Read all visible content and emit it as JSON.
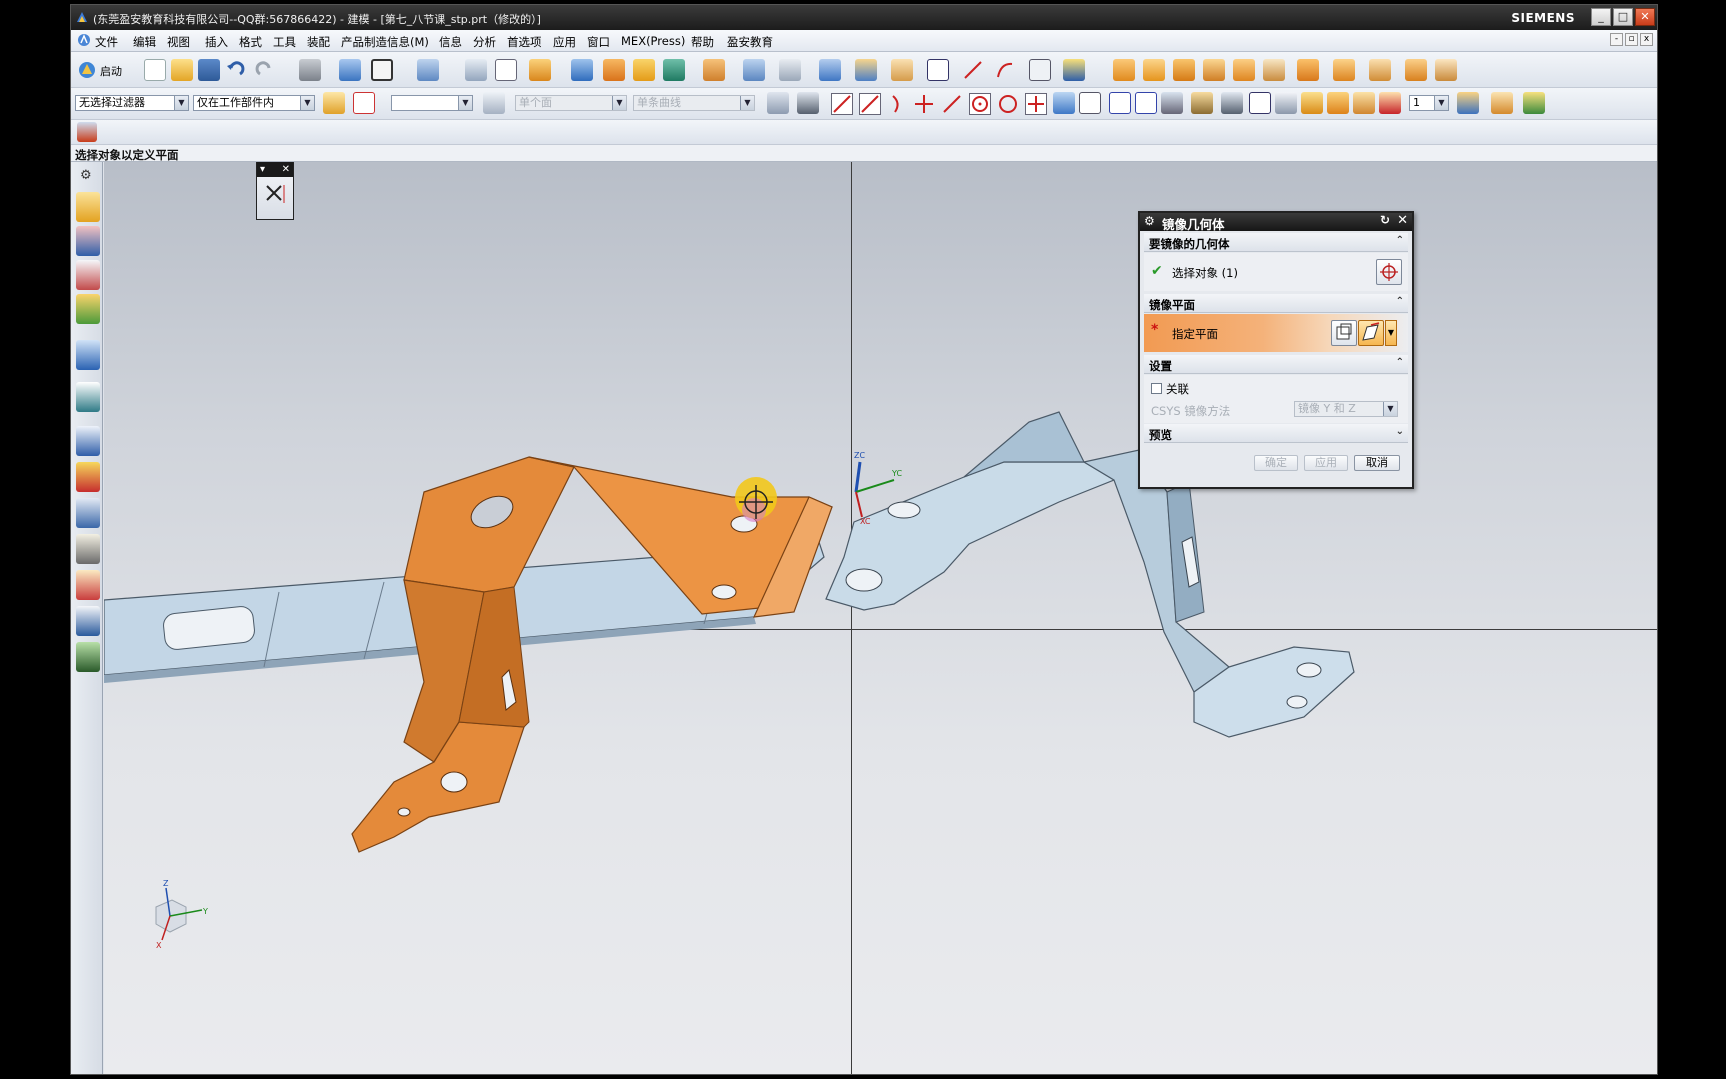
{
  "window": {
    "title": "(东莞盈安教育科技有限公司--QQ群:567866422) - 建模 - [第七_八节课_stp.prt（修改的）]",
    "brand": "SIEMENS"
  },
  "menu": [
    "文件",
    "编辑",
    "视图",
    "插入",
    "格式",
    "工具",
    "装配",
    "产品制造信息(M)",
    "信息",
    "分析",
    "首选项",
    "应用",
    "窗口",
    "MEX(Press)",
    "帮助",
    "盈安教育"
  ],
  "toolbar": {
    "start_label": "启动",
    "filter_value": "无选择过滤器",
    "scope_value": "仅在工作部件内",
    "face_rule": "单个面",
    "curve_rule": "单条曲线",
    "snap_count": "1"
  },
  "cue_line": "选择对象以定义平面",
  "dialog": {
    "title": "镜像几何体",
    "group1": "要镜像的几何体",
    "select_objects": "选择对象 (1)",
    "group2": "镜像平面",
    "specify_plane": "指定平面",
    "group3": "设置",
    "associative": "关联",
    "csys_method_label": "CSYS 镜像方法",
    "csys_method_value": "镜像 Y 和 Z",
    "group4": "预览",
    "ok": "确定",
    "apply": "应用",
    "cancel": "取消"
  },
  "axes_labels": {
    "zc": "ZC",
    "yc": "YC",
    "xc": "XC",
    "z": "Z",
    "y": "Y",
    "x": "X"
  },
  "colors": {
    "selected_part": "#e8893a",
    "part": "#b9d2e4",
    "dialog_highlight": "#f29a52"
  }
}
